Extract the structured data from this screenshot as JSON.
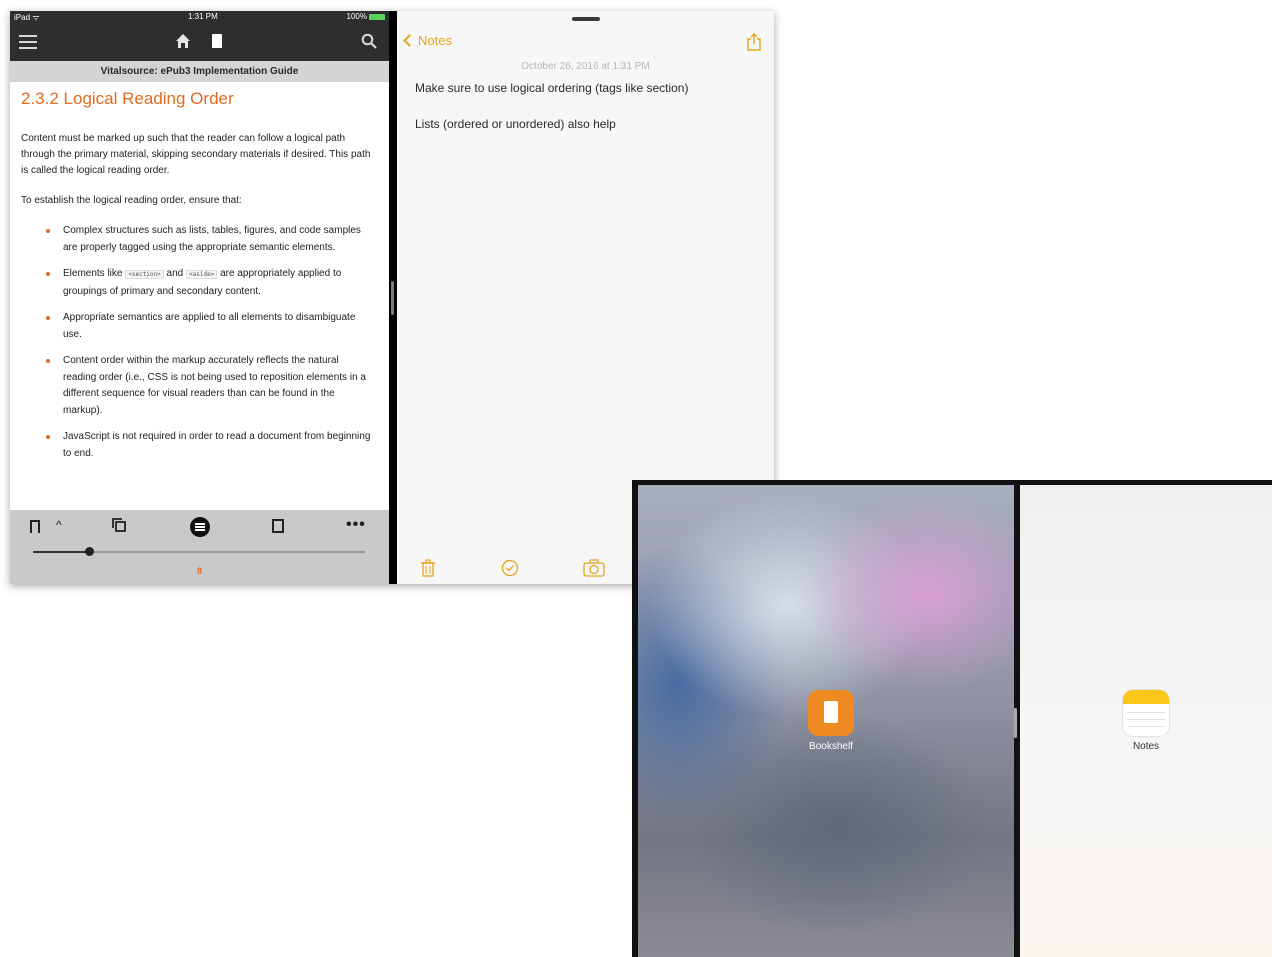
{
  "reader": {
    "status_bar": {
      "left": "iPad ᯤ",
      "time": "1:31 PM",
      "battery": "100%"
    },
    "book_title": "Vitalsource: ePub3 Implementation Guide",
    "heading": "2.3.2 Logical Reading Order",
    "paragraph1": "Content must be marked up such that the reader can follow a logical path through the primary material, skipping secondary materials if desired. This path is called the logical reading order.",
    "paragraph2": "To establish the logical reading order, ensure that:",
    "bullets": [
      "Complex structures such as lists, tables, figures, and code samples are properly tagged using the appropriate semantic elements.",
      "Appropriate semantics are applied to all elements to disambiguate use.",
      "Content order within the markup accurately reflects the natural reading order (i.e., CSS is not being used to reposition elements in a different sequence for visual readers than can be found in the markup).",
      "JavaScript is not required in order to read a document from beginning to end."
    ],
    "bullet_elements": {
      "prefix": "Elements like",
      "code1": "<section>",
      "middle": "and",
      "code2": "<aside>",
      "suffix": "are appropriately applied to groupings of primary and secondary content."
    },
    "more_label": "•••",
    "caret_label": "^",
    "page_number": "8",
    "progress": 0.17,
    "accent_color": "#e06b1e"
  },
  "notes": {
    "back_label": "Notes",
    "date": "October 26, 2016 at 1:31 PM",
    "lines": [
      "Make sure to use logical ordering (tags like section)",
      "Lists (ordered or unordered) also help"
    ],
    "accent_color": "#e9a319"
  },
  "switcher": {
    "left_app": "Bookshelf",
    "right_app": "Notes"
  }
}
